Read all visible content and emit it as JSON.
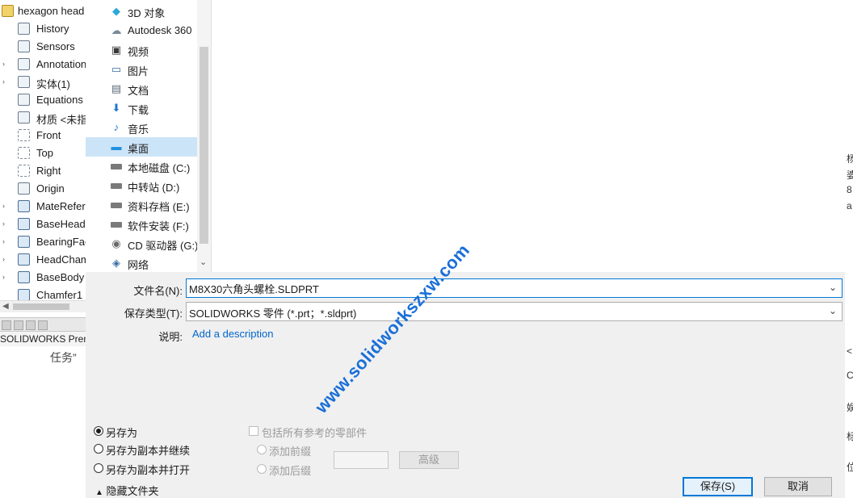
{
  "tree": {
    "root_label": "hexagon head",
    "items": [
      {
        "label": "History",
        "arrow": ""
      },
      {
        "label": "Sensors",
        "arrow": ""
      },
      {
        "label": "Annotation",
        "arrow": "›"
      },
      {
        "label": "实体(1)",
        "arrow": "›"
      },
      {
        "label": "Equations",
        "arrow": ""
      },
      {
        "label": "材质 <未指",
        "arrow": ""
      },
      {
        "label": "Front",
        "arrow": ""
      },
      {
        "label": "Top",
        "arrow": ""
      },
      {
        "label": "Right",
        "arrow": ""
      },
      {
        "label": "Origin",
        "arrow": ""
      },
      {
        "label": "MateRefer",
        "arrow": "›"
      },
      {
        "label": "BaseHead",
        "arrow": "›"
      },
      {
        "label": "BearingFac",
        "arrow": "›"
      },
      {
        "label": "HeadCham",
        "arrow": "›"
      },
      {
        "label": "BaseBody",
        "arrow": "›"
      },
      {
        "label": "Chamfer1",
        "arrow": ""
      }
    ]
  },
  "app": {
    "title": "SOLIDWORKS Prem",
    "task_text": "任务”"
  },
  "nav": {
    "items": [
      {
        "label": "3D 对象",
        "icon": "cube-icon",
        "glyph": "◆",
        "color": "#2aa8d8"
      },
      {
        "label": "Autodesk 360",
        "icon": "cloud-icon",
        "glyph": "☁",
        "color": "#7a8a9a"
      },
      {
        "label": "视频",
        "icon": "video-icon",
        "glyph": "▣",
        "color": "#3a3a3a"
      },
      {
        "label": "图片",
        "icon": "picture-icon",
        "glyph": "▭",
        "color": "#3a6ea5"
      },
      {
        "label": "文档",
        "icon": "document-icon",
        "glyph": "▤",
        "color": "#5a6a7a"
      },
      {
        "label": "下载",
        "icon": "download-icon",
        "glyph": "⬇",
        "color": "#1e78d2"
      },
      {
        "label": "音乐",
        "icon": "music-icon",
        "glyph": "♪",
        "color": "#1e78d2"
      },
      {
        "label": "桌面",
        "icon": "desktop-icon",
        "glyph": "▬",
        "color": "#1e90e0"
      },
      {
        "label": "本地磁盘 (C:)",
        "icon": "drive-icon",
        "glyph": "",
        "color": "#6a6a6a"
      },
      {
        "label": "中转站 (D:)",
        "icon": "drive-icon",
        "glyph": "",
        "color": "#6a6a6a"
      },
      {
        "label": "资料存档 (E:)",
        "icon": "drive-icon",
        "glyph": "",
        "color": "#6a6a6a"
      },
      {
        "label": "软件安装 (F:)",
        "icon": "drive-icon",
        "glyph": "",
        "color": "#6a6a6a"
      },
      {
        "label": "CD 驱动器 (G:)",
        "icon": "cd-icon",
        "glyph": "◉",
        "color": "#6a6a6a"
      },
      {
        "label": "网络",
        "icon": "network-icon",
        "glyph": "◈",
        "color": "#3a6ea5"
      }
    ],
    "selected_index": 7
  },
  "form": {
    "filename_label": "文件名(N):",
    "filename_value": "M8X30六角头螺栓.SLDPRT",
    "type_label": "保存类型(T):",
    "type_value": "SOLIDWORKS 零件 (*.prt；*.sldprt)",
    "desc_label": "说明:",
    "desc_link": "Add a description"
  },
  "options": {
    "save_as": "另存为",
    "save_copy_continue": "另存为副本并继续",
    "save_copy_open": "另存为副本并打开",
    "include_refs": "包括所有参考的零部件",
    "add_prefix": "添加前缀",
    "add_suffix": "添加后缀",
    "advanced": "高级",
    "hide_folders": "隐藏文件夹"
  },
  "buttons": {
    "save": "保存(S)",
    "cancel": "取消"
  },
  "watermark": "www.solidworkszxw.com",
  "right_edge_chars": [
    "杨",
    "婆",
    "8",
    "a",
    "<",
    "C",
    "娱",
    "标",
    "位"
  ]
}
